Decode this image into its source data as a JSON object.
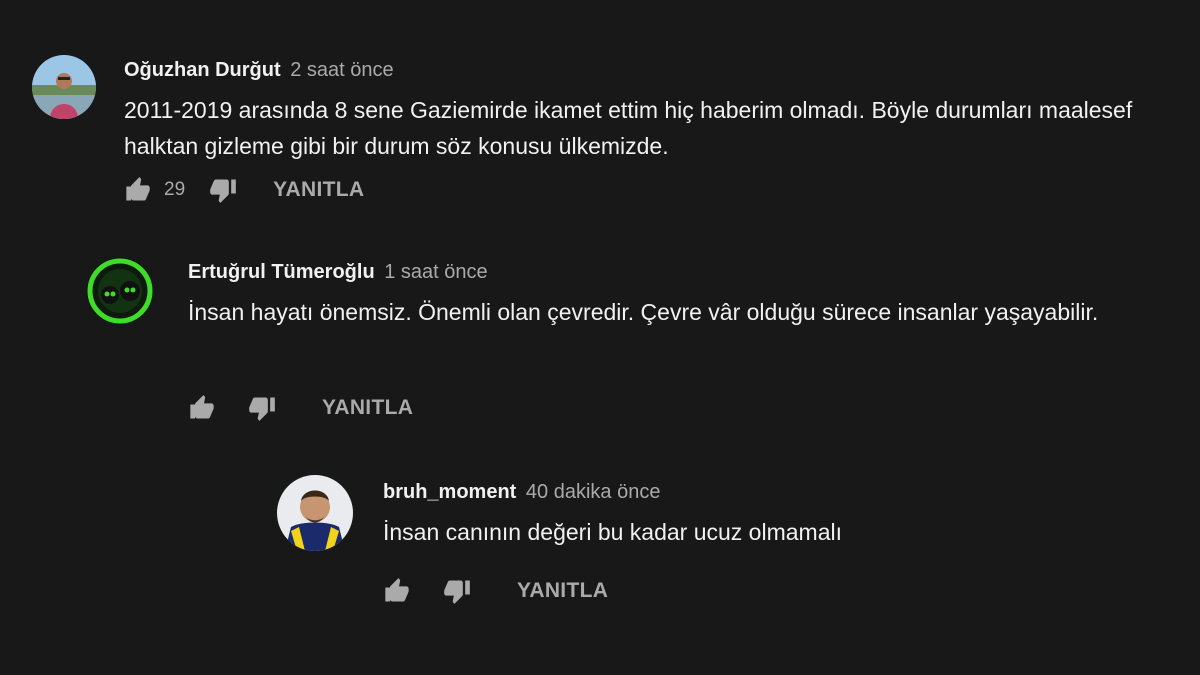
{
  "comments": [
    {
      "author": "Oğuzhan Durğut",
      "time": "2 saat önce",
      "text": "2011-2019 arasında 8 sene Gaziemirde ikamet ettim hiç haberim olmadı. Böyle durumları maalesef halktan gizleme gibi bir durum söz konusu ülkemizde.",
      "likes": "29",
      "reply_label": "YANITLA"
    },
    {
      "author": "Ertuğrul Tümeroğlu",
      "time": "1 saat önce",
      "text": "İnsan hayatı önemsiz. Önemli olan çevredir. Çevre vâr olduğu sürece insanlar yaşayabilir.",
      "likes": "",
      "reply_label": "YANITLA"
    },
    {
      "author": "bruh_moment",
      "time": "40 dakika önce",
      "text": "İnsan canının değeri bu kadar ucuz olmamalı",
      "likes": "",
      "reply_label": "YANITLA"
    }
  ],
  "icons": {
    "like": "thumbs-up-icon",
    "dislike": "thumbs-down-icon"
  },
  "colors": {
    "background": "#181818",
    "text": "#f1f1f1",
    "secondary": "#aaaaaa"
  }
}
